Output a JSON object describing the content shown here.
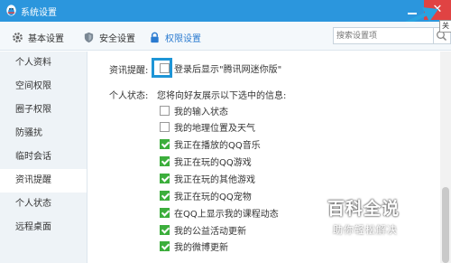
{
  "window": {
    "title": "系统设置",
    "close_tooltip": "关"
  },
  "toolbar": {
    "tabs": [
      {
        "label": "基本设置",
        "icon": "gear-icon"
      },
      {
        "label": "安全设置",
        "icon": "shield-icon"
      },
      {
        "label": "权限设置",
        "icon": "lock-icon"
      }
    ],
    "active_tab": "权限设置",
    "search_placeholder": "搜索设置项"
  },
  "sidebar": {
    "items": [
      {
        "label": "个人资料"
      },
      {
        "label": "空间权限"
      },
      {
        "label": "圈子权限"
      },
      {
        "label": "防骚扰"
      },
      {
        "label": "临时会话"
      },
      {
        "label": "资讯提醒"
      },
      {
        "label": "个人状态"
      },
      {
        "label": "远程桌面"
      }
    ],
    "active": "资讯提醒"
  },
  "main": {
    "news_label": "资讯提醒:",
    "news_option": {
      "label": "登录后显示\"腾讯网迷你版\"",
      "checked": false
    },
    "status_label": "个人状态:",
    "status_desc": "您将向好友展示以下选中的信息:",
    "status_options": [
      {
        "label": "我的输入状态",
        "checked": false
      },
      {
        "label": "我的地理位置及天气",
        "checked": false
      },
      {
        "label": "我正在播放的QQ音乐",
        "checked": true
      },
      {
        "label": "我正在玩的QQ游戏",
        "checked": true
      },
      {
        "label": "我正在玩的其他游戏",
        "checked": true
      },
      {
        "label": "我正在玩的QQ宠物",
        "checked": true
      },
      {
        "label": "在QQ上显示我的课程动态",
        "checked": true
      },
      {
        "label": "我的公益活动更新",
        "checked": true
      },
      {
        "label": "我的微博更新",
        "checked": true
      }
    ]
  },
  "watermark": {
    "title": "百科全说",
    "subtitle": "助你轻松解决"
  },
  "colors": {
    "titlebar": "#2b96dd",
    "close": "#e04343",
    "highlight": "#1e95d6",
    "check": "#3cae3c",
    "active_tab": "#2b7bd0"
  }
}
